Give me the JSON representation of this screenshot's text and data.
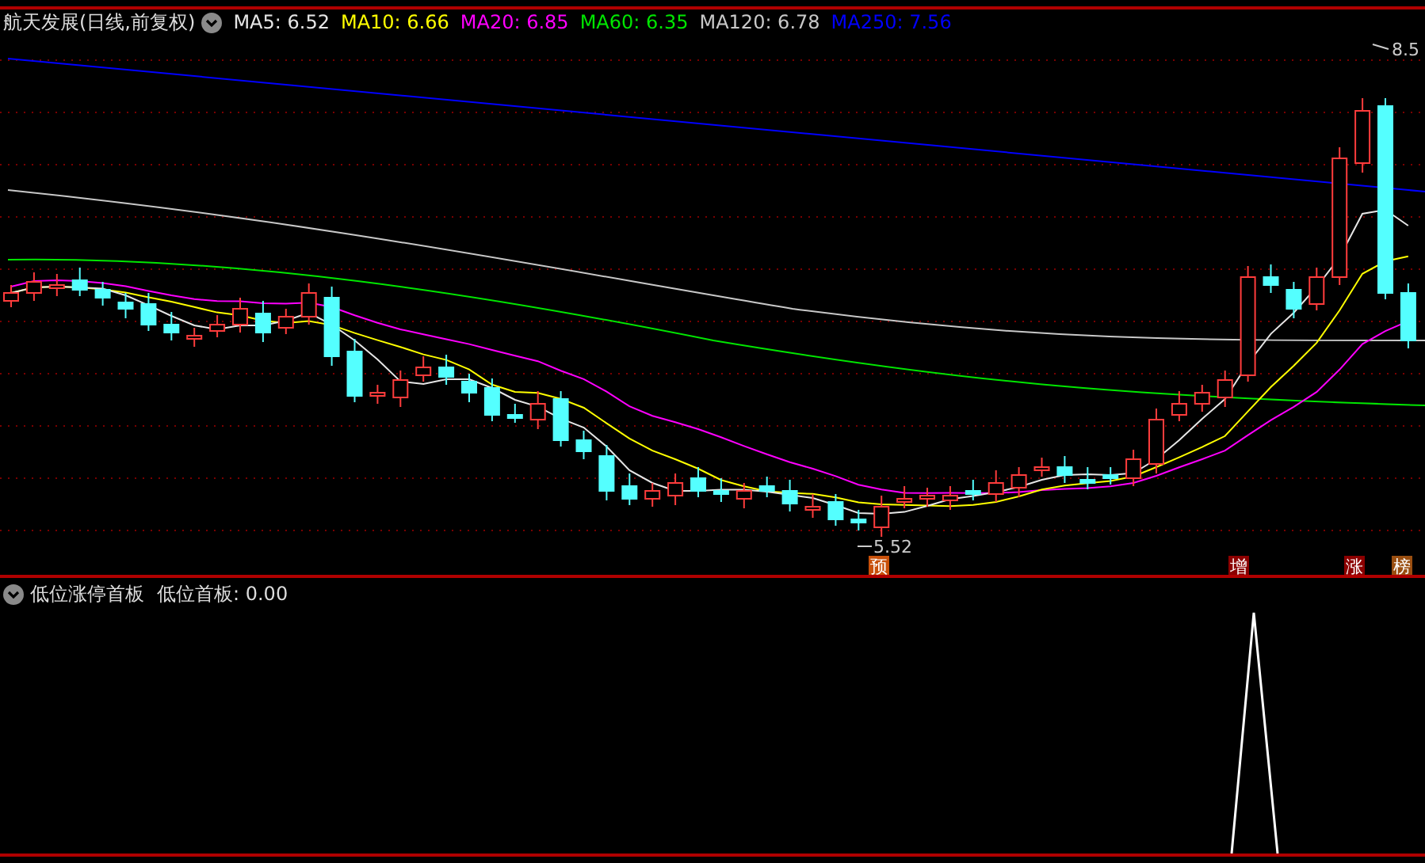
{
  "main_panel": {
    "title": "航天发展(日线,前复权)",
    "indicators": [
      {
        "label": "MA5:",
        "value": "6.52",
        "color": "#e6e6e6"
      },
      {
        "label": "MA10:",
        "value": "6.66",
        "color": "#ffff00"
      },
      {
        "label": "MA20:",
        "value": "6.85",
        "color": "#ff00ff"
      },
      {
        "label": "MA60:",
        "value": "6.35",
        "color": "#00e600"
      },
      {
        "label": "MA120:",
        "value": "6.78",
        "color": "#c8c8c8"
      },
      {
        "label": "MA250:",
        "value": "7.56",
        "color": "#0000ff"
      }
    ],
    "high_label": "8.5",
    "low_label": "5.52",
    "signals": [
      {
        "text": "预",
        "color": "#c8500a"
      },
      {
        "text": "增",
        "color": "#8c0000"
      },
      {
        "text": "涨",
        "color": "#8c0000"
      },
      {
        "text": "榜",
        "color": "#9a4e10"
      }
    ]
  },
  "lower_panel": {
    "title": "低位涨停首板",
    "indicator": "低位首板:",
    "value": "0.00"
  }
}
